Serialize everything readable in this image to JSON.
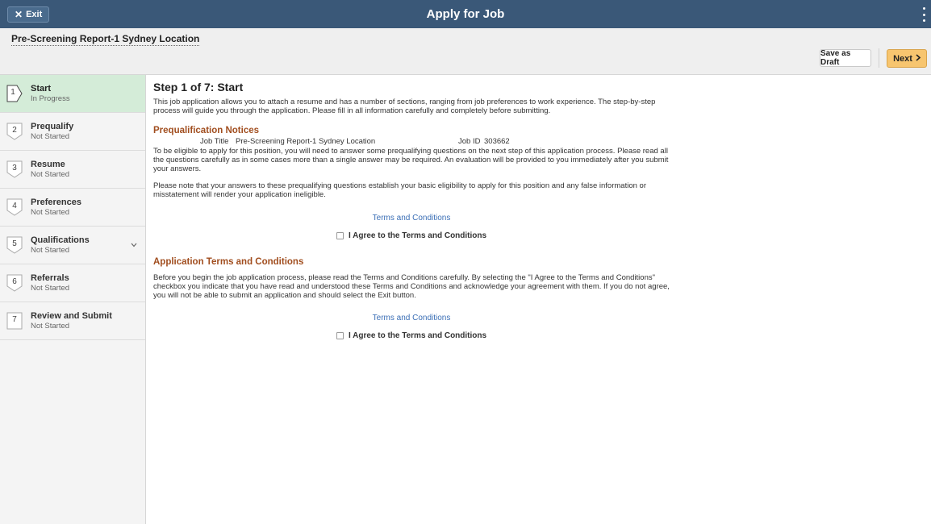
{
  "banner": {
    "exit_label": "Exit",
    "title": "Apply for Job"
  },
  "subheader": {
    "report_title": "Pre-Screening Report-1 Sydney Location",
    "save_draft_label": "Save as Draft",
    "next_label": "Next"
  },
  "steps": [
    {
      "num": "1",
      "name": "Start",
      "status": "In Progress"
    },
    {
      "num": "2",
      "name": "Prequalify",
      "status": "Not Started"
    },
    {
      "num": "3",
      "name": "Resume",
      "status": "Not Started"
    },
    {
      "num": "4",
      "name": "Preferences",
      "status": "Not Started"
    },
    {
      "num": "5",
      "name": "Qualifications",
      "status": "Not Started"
    },
    {
      "num": "6",
      "name": "Referrals",
      "status": "Not Started"
    },
    {
      "num": "7",
      "name": "Review and Submit",
      "status": "Not Started"
    }
  ],
  "main": {
    "heading": "Step 1 of 7: Start",
    "intro": "This job application allows you to attach a resume and has a number of sections, ranging from job preferences to work experience. The step-by-step process will guide you through the application. Please fill in all information carefully and completely before submitting.",
    "prequal": {
      "heading": "Prequalification Notices",
      "job_title_label": "Job Title",
      "job_title_value": "Pre-Screening Report-1 Sydney Location",
      "job_id_label": "Job ID",
      "job_id_value": "303662",
      "para1": "To be eligible to apply for this position, you will need to answer some prequalifying questions on the next step of this application process. Please read all the questions carefully as in some cases more than a single answer may be required. An evaluation will be provided to you immediately after you submit your answers.",
      "para2": "Please note that your answers to these prequalifying questions establish your basic eligibility to apply for this position and any false information or misstatement will render your application ineligible.",
      "terms_link": "Terms and Conditions",
      "agree_label": "I Agree to the Terms and Conditions"
    },
    "app_terms": {
      "heading": "Application Terms and Conditions",
      "para": "Before you begin the job application process, please read the Terms and Conditions carefully. By selecting the \"I Agree to the Terms and Conditions\" checkbox you indicate that you have read and understood these Terms and Conditions and acknowledge your agreement with them. If you do not agree, you will not be able to submit an application and should select the Exit button.",
      "terms_link": "Terms and Conditions",
      "agree_label": "I Agree to the Terms and Conditions"
    }
  }
}
